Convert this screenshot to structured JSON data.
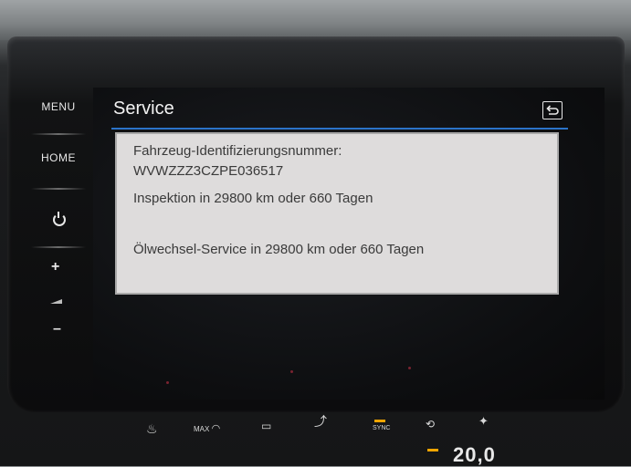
{
  "hardkeys": {
    "menu": "MENU",
    "home": "HOME",
    "vol_plus": "+",
    "vol_minus": "–"
  },
  "header": {
    "title": "Service"
  },
  "service_info": {
    "vin_label": "Fahrzeug-Identifizierungsnummer:",
    "vin_value": "WVWZZZ3CZPE036517",
    "inspection": "Inspektion in 29800 km oder 660 Tagen",
    "oil_service": "Ölwechsel-Service in 29800 km oder 660 Tagen"
  },
  "climate": {
    "max_defrost": "MAX",
    "sync": "SYNC",
    "temperature": "20,0"
  },
  "colors": {
    "accent_line": "#2b73c9",
    "panel_bg": "#dedcdc",
    "indicator": "#f0a500"
  },
  "icons": [
    "power-icon",
    "back-icon",
    "seat-heat-icon",
    "defrost-icon",
    "rear-defrost-icon",
    "air-recirculation-icon",
    "seat-airflow-icon",
    "fan-icon"
  ]
}
